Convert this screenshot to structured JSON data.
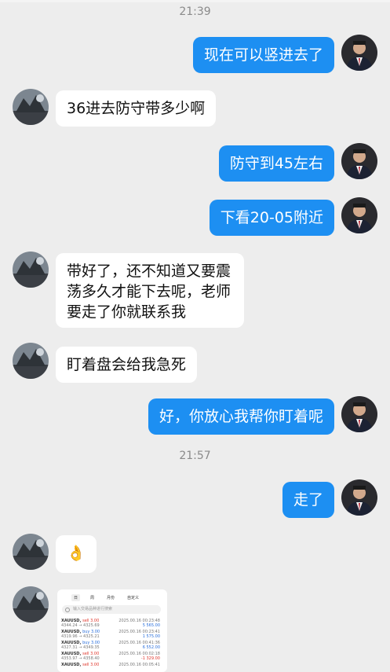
{
  "timestamps": [
    "21:39",
    "21:57"
  ],
  "messages": [
    {
      "side": "out",
      "text": "现在可以竖进去了"
    },
    {
      "side": "in",
      "text": "36进去防守带多少啊"
    },
    {
      "side": "out",
      "text": "防守到45左右"
    },
    {
      "side": "out",
      "text": "下看20-05附近"
    },
    {
      "side": "in",
      "text": "带好了，还不知道又要震\n荡多久才能下去呢，老师\n要走了你就联系我"
    },
    {
      "side": "in",
      "text": "盯着盘会给我急死"
    },
    {
      "side": "out",
      "text": "好，你放心我帮你盯着呢"
    },
    {
      "side": "out",
      "text": "走了"
    },
    {
      "side": "in",
      "text": "👌"
    }
  ],
  "screenshot": {
    "tabs": [
      "日",
      "周",
      "月份",
      "自定义"
    ],
    "search_placeholder": "输入交易品种进行搜索",
    "trades": [
      {
        "symbol": "XAUUSD,",
        "action": "sell 3.00",
        "action_color": "red",
        "prices": "4344.24 → 4325.69",
        "date": "2025.00.16 00:23:48",
        "pl": "5 565.00",
        "pl_color": "blue"
      },
      {
        "symbol": "XAUUSD,",
        "action": "buy 3.00",
        "action_color": "blue",
        "prices": "4319.96 → 4325.21",
        "date": "2025.00.16 00:23:41",
        "pl": "1 575.00",
        "pl_color": "blue"
      },
      {
        "symbol": "XAUUSD,",
        "action": "buy 3.00",
        "action_color": "blue",
        "prices": "4327.31 → 4349.35",
        "date": "2025.00.16 00:41:36",
        "pl": "6 552.00",
        "pl_color": "blue"
      },
      {
        "symbol": "XAUUSD,",
        "action": "sell 3.00",
        "action_color": "red",
        "prices": "4353.97 → 4358.40",
        "date": "2025.00.16 00:02:18",
        "pl": "-1 329.00",
        "pl_color": "red"
      },
      {
        "symbol": "XAUUSD,",
        "action": "sell 3.00",
        "action_color": "red",
        "prices": "",
        "date": "2025.00.16 00:05:41",
        "pl": "",
        "pl_color": "red"
      }
    ]
  }
}
